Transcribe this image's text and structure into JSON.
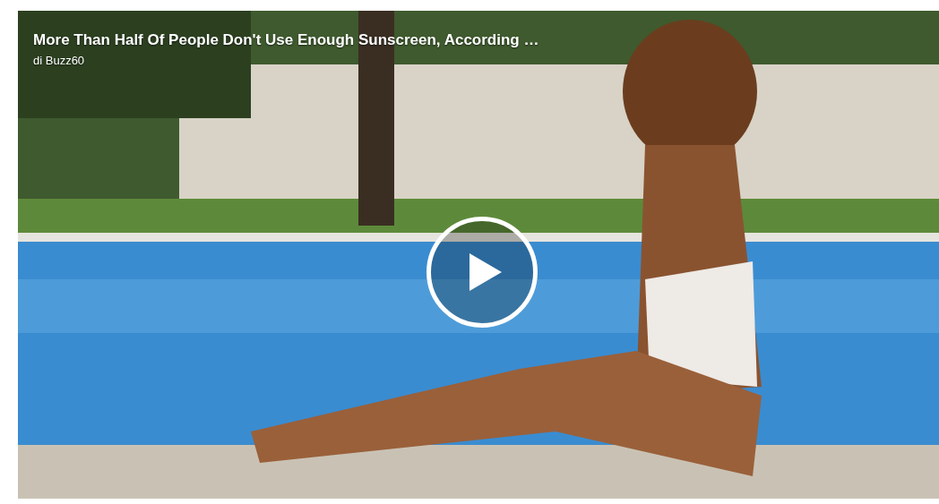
{
  "video": {
    "kind": "picture",
    "title": "More Than Half Of People Don't Use Enough Sunscreen, According …",
    "byline": "di Buzz60"
  }
}
